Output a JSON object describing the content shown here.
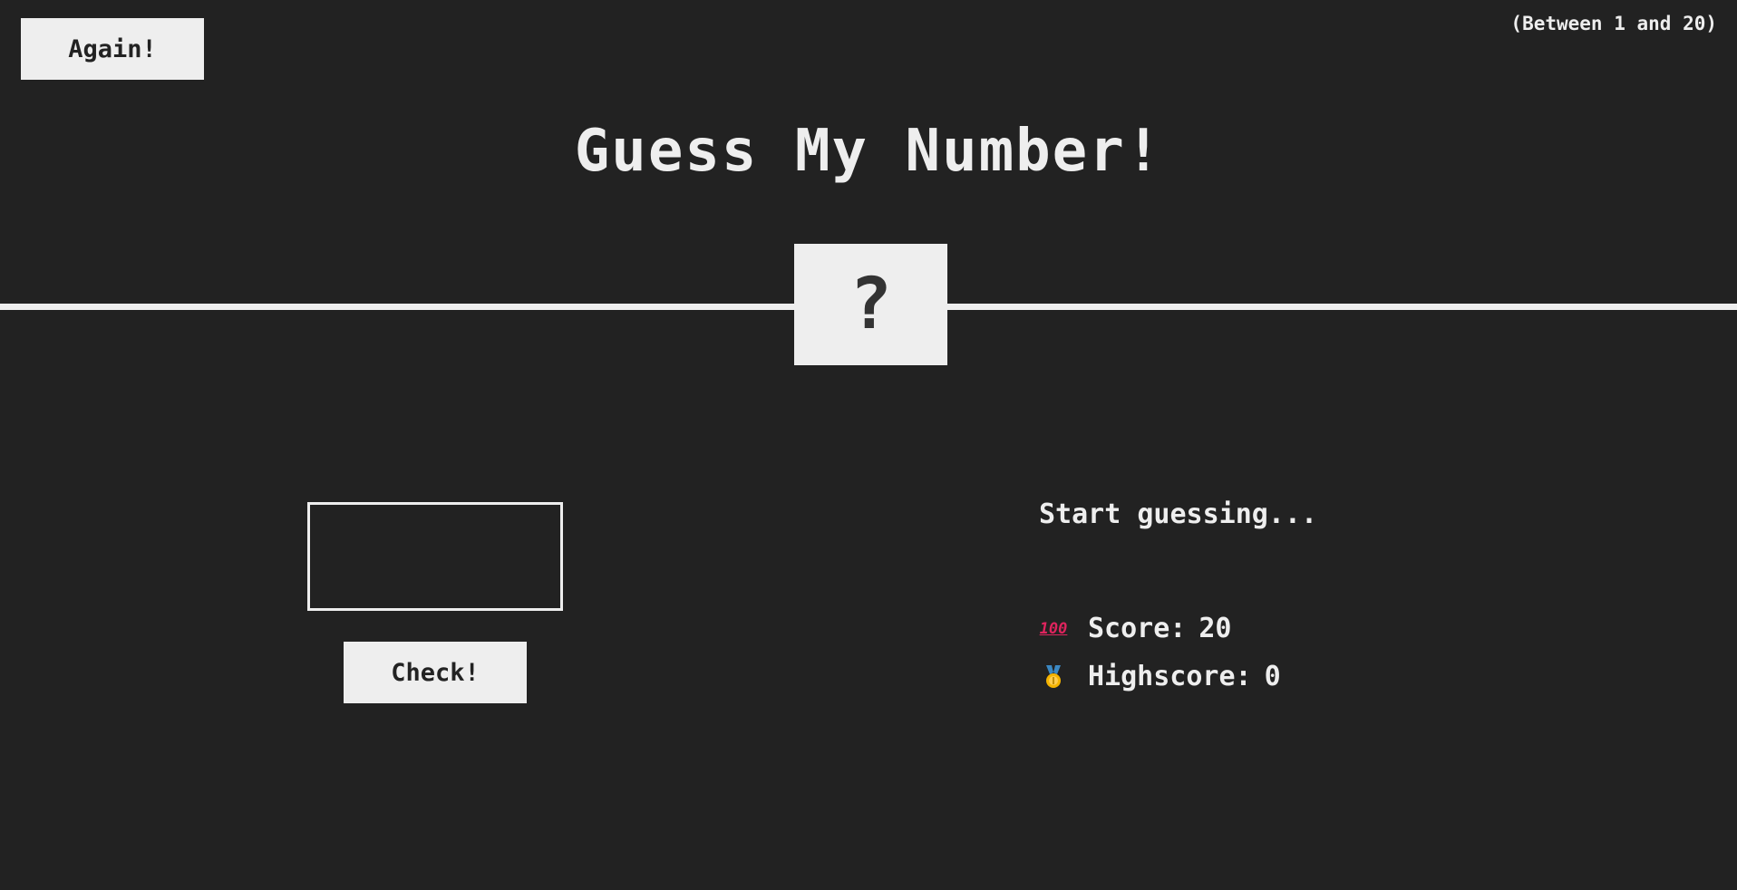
{
  "header": {
    "again_label": "Again!",
    "range_hint": "(Between 1 and 20)",
    "title": "Guess My Number!"
  },
  "number_box": {
    "value": "?"
  },
  "left": {
    "guess_value": "",
    "check_label": "Check!"
  },
  "right": {
    "message": "Start guessing...",
    "score": {
      "icon": "hundred-points-icon",
      "icon_text": "100",
      "label": "Score:",
      "value": "20"
    },
    "highscore": {
      "icon": "medal-icon",
      "label": "Highscore:",
      "value": "0"
    }
  },
  "colors": {
    "background": "#222222",
    "foreground": "#eeeeee",
    "box_text": "#333333",
    "hundred_icon": "#e0245e",
    "medal_gold": "#f5b400",
    "medal_ribbon": "#3b88c3"
  }
}
